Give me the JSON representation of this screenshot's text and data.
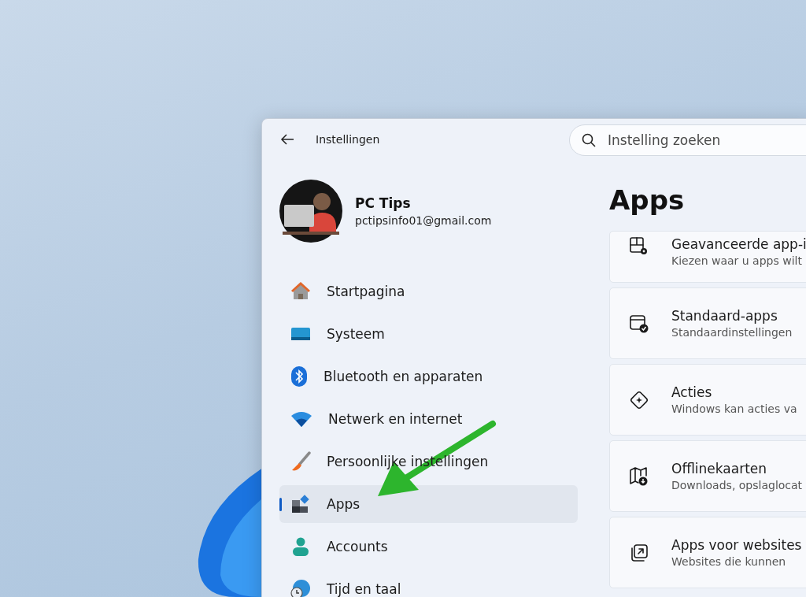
{
  "window": {
    "title": "Instellingen"
  },
  "search": {
    "placeholder": "Instelling zoeken"
  },
  "profile": {
    "name": "PC Tips",
    "email": "pctipsinfo01@gmail.com"
  },
  "sidebar": {
    "items": [
      {
        "label": "Startpagina",
        "selected": false
      },
      {
        "label": "Systeem",
        "selected": false
      },
      {
        "label": "Bluetooth en apparaten",
        "selected": false
      },
      {
        "label": "Netwerk en internet",
        "selected": false
      },
      {
        "label": "Persoonlijke instellingen",
        "selected": false
      },
      {
        "label": "Apps",
        "selected": true
      },
      {
        "label": "Accounts",
        "selected": false
      },
      {
        "label": "Tijd en taal",
        "selected": false
      }
    ]
  },
  "page": {
    "title": "Apps"
  },
  "cards": [
    {
      "title": "Geavanceerde app-i",
      "description": "Kiezen waar u apps wilt"
    },
    {
      "title": "Standaard-apps",
      "description": "Standaardinstellingen"
    },
    {
      "title": "Acties",
      "description": "Windows kan acties va"
    },
    {
      "title": "Offlinekaarten",
      "description": "Downloads, opslaglocat"
    },
    {
      "title": "Apps voor websites",
      "description": "Websites die kunnen"
    }
  ]
}
